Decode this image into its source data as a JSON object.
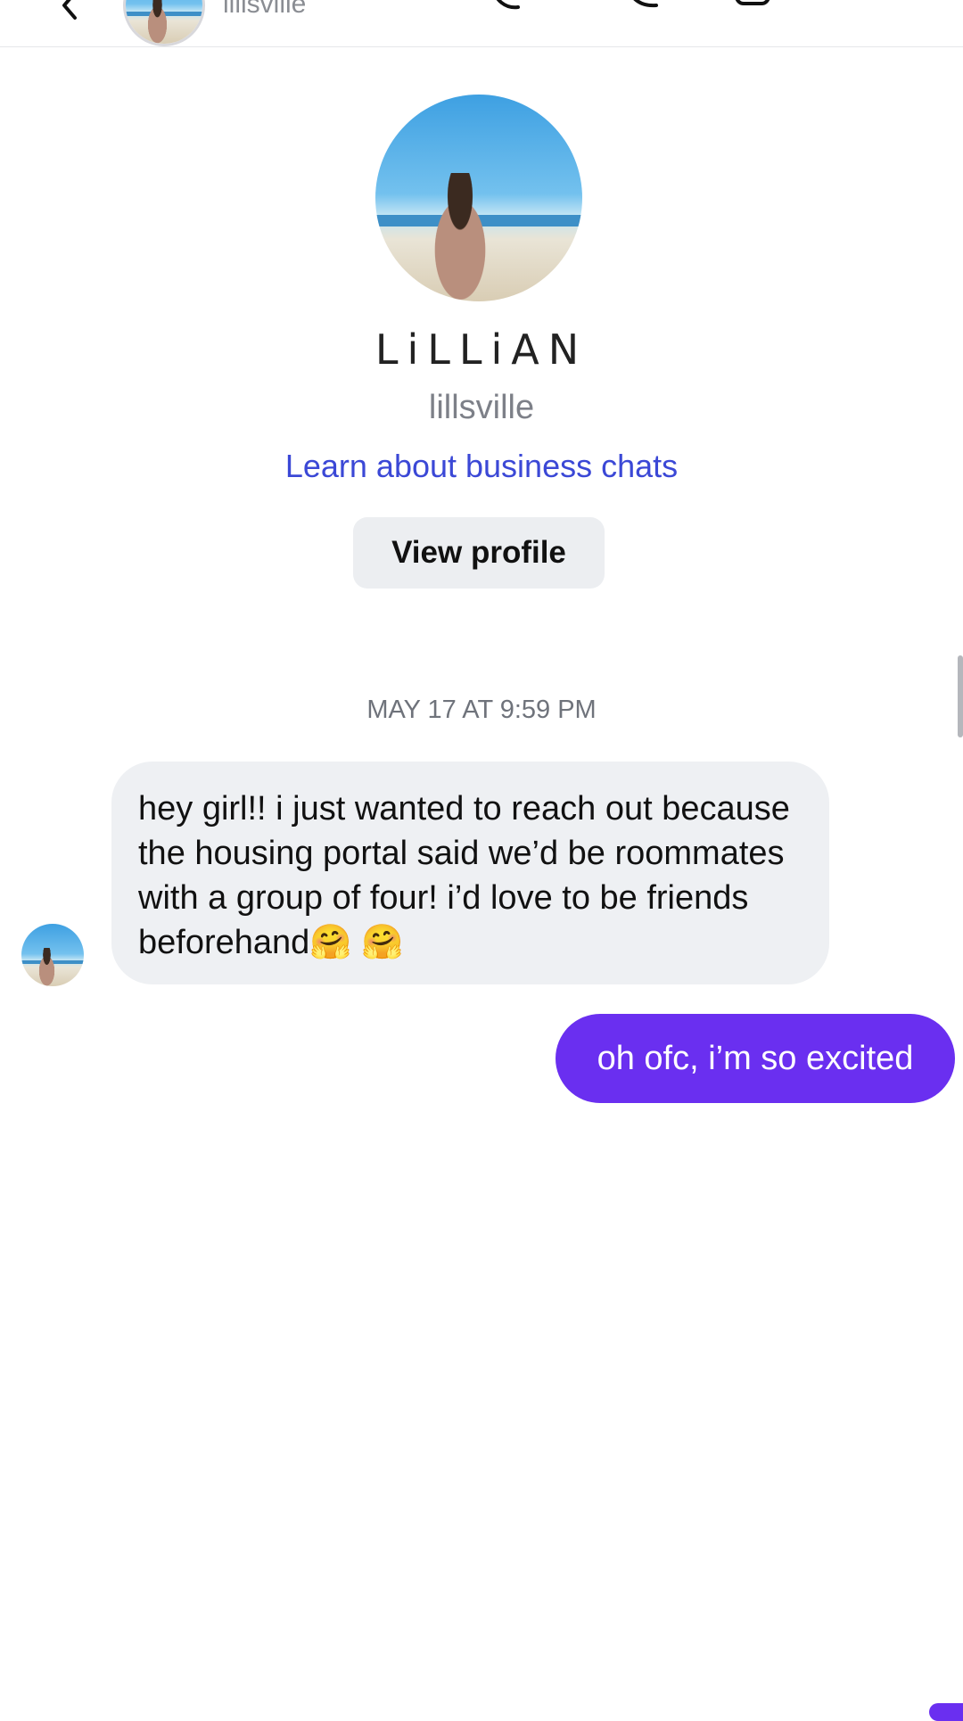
{
  "header": {
    "username": "lillsville",
    "icons": [
      "back-chevron-icon",
      "avatar",
      "phone-icon",
      "video-icon",
      "info-icon"
    ]
  },
  "profile": {
    "display_name": "LiLLiAN",
    "username": "lillsville",
    "business_link": "Learn about business chats",
    "view_profile_label": "View profile"
  },
  "conversation": {
    "timestamp": "MAY 17 AT 9:59 PM",
    "messages": [
      {
        "direction": "incoming",
        "text": "hey girl!! i just wanted to reach out because the housing portal said we’d be roommates with a group of four! i’d love to be friends beforehand🤗 🤗"
      },
      {
        "direction": "outgoing",
        "text": "oh ofc, i’m so excited"
      }
    ]
  },
  "colors": {
    "accent_purple": "#6a2ff0",
    "link_blue": "#3b48d6",
    "bubble_gray": "#eef0f3"
  }
}
